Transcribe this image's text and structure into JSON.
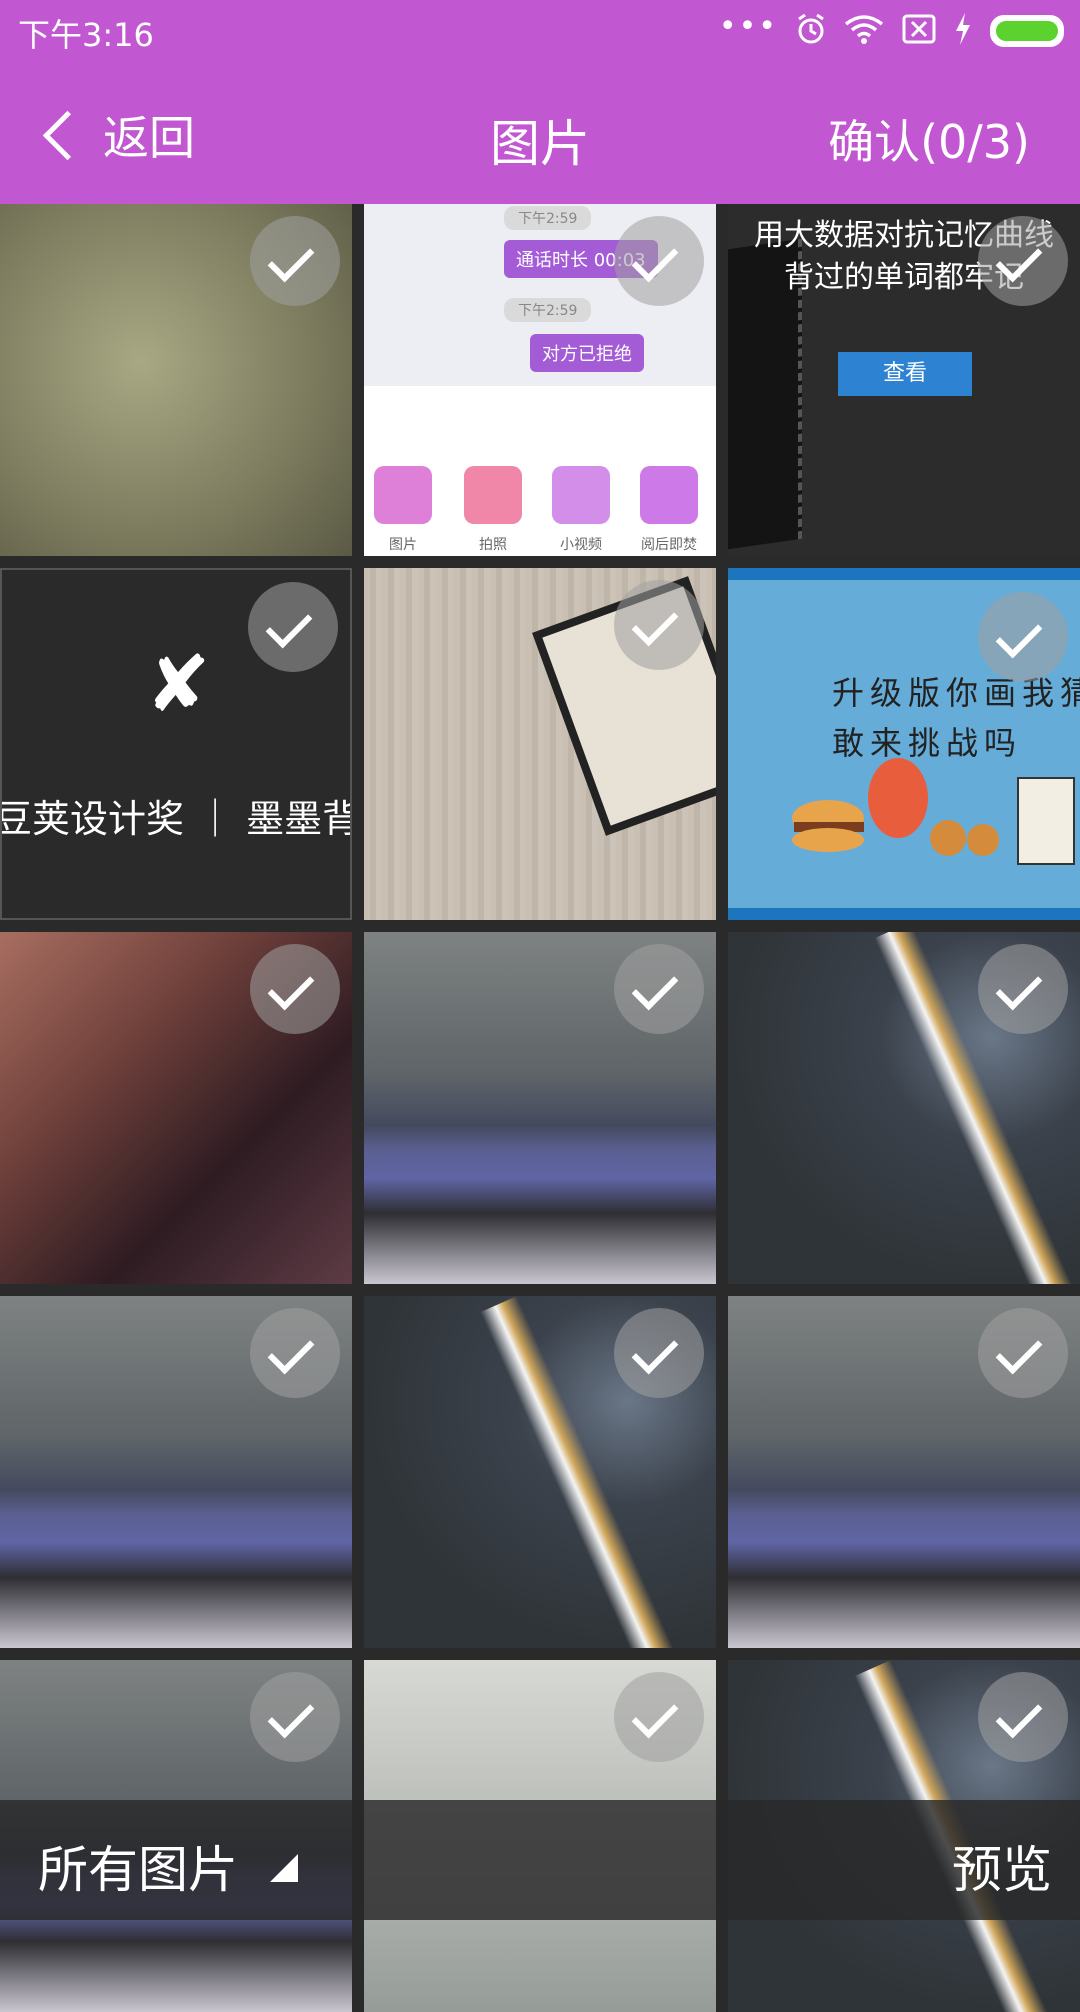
{
  "status_bar": {
    "time": "下午3:16",
    "icons": [
      "more-dots-icon",
      "alarm-icon",
      "wifi-icon",
      "sim-off-icon",
      "charging-icon",
      "battery-icon"
    ],
    "battery_color": "#5bd22e"
  },
  "header": {
    "back_label": "返回",
    "title": "图片",
    "confirm_label": "确认(0/3)",
    "bg_color": "#c157d1"
  },
  "tiles": {
    "chat": {
      "time1": "下午2:59",
      "bubble1": "通话时长 00:03",
      "time2": "下午2:59",
      "bubble2": "对方已拒绝",
      "icons": [
        "图片",
        "拍照",
        "小视频",
        "阅后即焚"
      ]
    },
    "ad": {
      "line1": "用大数据对抗记忆曲线",
      "line2": "背过的单词都牢记",
      "button": "查看"
    },
    "award": {
      "text": "豆荚设计奖 ｜ 墨墨背"
    },
    "game": {
      "line1": "升级版你画我猜",
      "line2": "敢来挑战吗"
    }
  },
  "footer": {
    "album_label": "所有图片",
    "preview_label": "预览"
  }
}
